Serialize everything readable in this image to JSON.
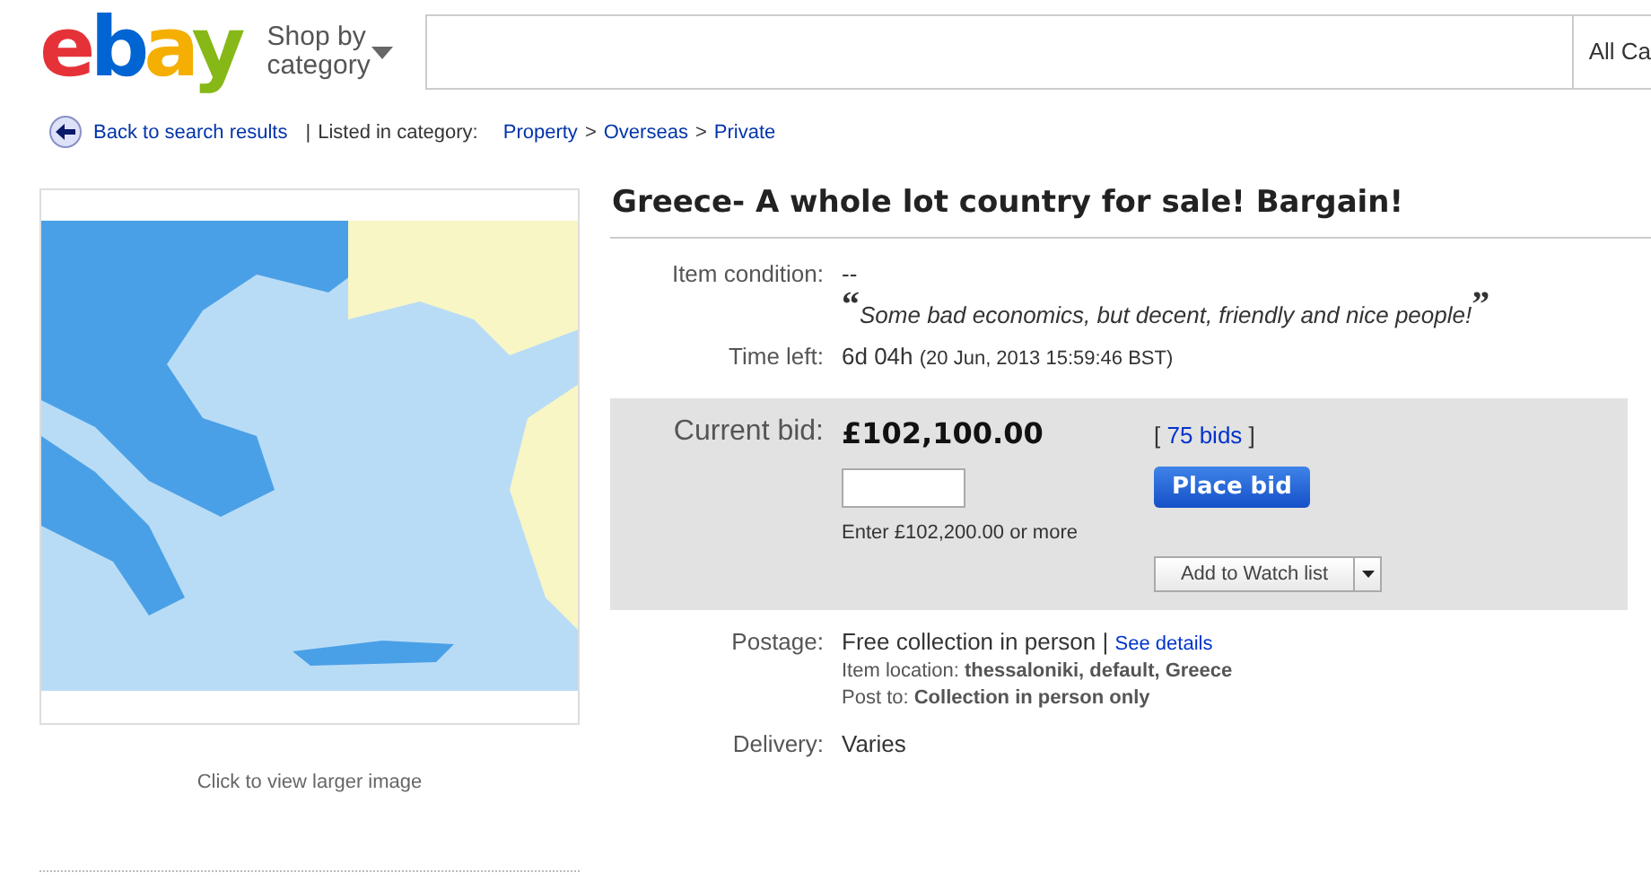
{
  "header": {
    "logo": "ebay",
    "shop_by": "Shop by category",
    "search": {
      "category": "All Ca"
    }
  },
  "breadcrumb": {
    "back": "Back to search results",
    "separator": "|",
    "listed_in": "Listed in category:",
    "path": [
      {
        "label": "Property"
      },
      {
        "label": "Overseas"
      },
      {
        "label": "Private"
      }
    ],
    "arrow": ">"
  },
  "gallery": {
    "caption": "Click to view larger image"
  },
  "item": {
    "title": "Greece- A whole lot country for sale! Bargain!",
    "condition": {
      "label": "Item condition:",
      "value": "--",
      "quote_open": "“",
      "quote": "Some bad economics, but decent, friendly and nice people!",
      "quote_close": "”"
    },
    "time_left": {
      "label": "Time left:",
      "value": "6d 04h",
      "end": "(20 Jun, 2013  15:59:46 BST)"
    },
    "bid": {
      "label": "Current bid:",
      "price": "£102,100.00",
      "bids_open": "[",
      "bids": "75 bids",
      "bids_close": "]",
      "hint": "Enter £102,200.00 or more",
      "place_bid": "Place bid",
      "watch": "Add to Watch list"
    },
    "postage": {
      "label": "Postage:",
      "value": "Free collection in person",
      "separator": "|",
      "details": "See details",
      "location_label": "Item location:",
      "location": "thessaloniki, default, Greece",
      "post_to_label": "Post to:",
      "post_to": "Collection in person only"
    },
    "delivery": {
      "label": "Delivery:",
      "value": "Varies"
    }
  }
}
